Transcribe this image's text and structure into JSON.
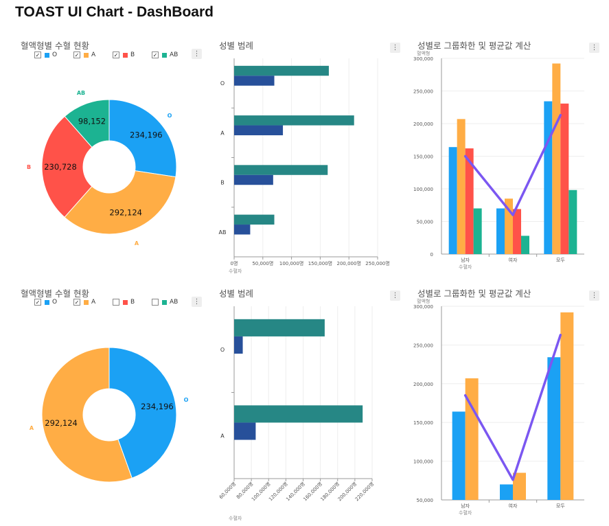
{
  "page_title": "TOAST UI Chart - DashBoard",
  "colors": {
    "O": "#1ba1f4",
    "A": "#ffad45",
    "B": "#ff5249",
    "AB": "#1cb392",
    "female": "#268785",
    "male": "#27509a",
    "avg": "#7b57f1"
  },
  "menu_icon": "⋮",
  "check_mark": "✓",
  "panels": {
    "pie_top": {
      "title": "혈액형별 수혈 현황"
    },
    "bar_top": {
      "title": "성별 범례",
      "ytitle": "혈액형",
      "xtitle": "수혈자"
    },
    "col_top": {
      "title": "성별로 그룹화한 및 평균값 계산",
      "ytitle": "혈액형",
      "xtitle": "수혈자"
    },
    "pie_bot": {
      "title": "혈액형별 수혈 현황"
    },
    "bar_bot": {
      "title": "성별 범례",
      "ytitle": "혈액형",
      "xtitle": "수혈자"
    },
    "col_bot": {
      "title": "성별로 그룹화한 및 평균값 계산",
      "ytitle": "혈액형",
      "xtitle": "수혈자"
    }
  },
  "legend_top": [
    {
      "label": "O",
      "checked": true
    },
    {
      "label": "A",
      "checked": true
    },
    {
      "label": "B",
      "checked": true
    },
    {
      "label": "AB",
      "checked": true
    }
  ],
  "legend_bot": [
    {
      "label": "O",
      "checked": true
    },
    {
      "label": "A",
      "checked": true
    },
    {
      "label": "B",
      "checked": false
    },
    {
      "label": "AB",
      "checked": false
    }
  ],
  "chart_data": [
    {
      "id": "pie_top",
      "type": "pie",
      "categories": [
        "O",
        "A",
        "B",
        "AB"
      ],
      "values": [
        234196,
        292124,
        230728,
        98152
      ],
      "labels": [
        "234,196",
        "292,124",
        "230,728",
        "98,152"
      ]
    },
    {
      "id": "bar_top",
      "type": "bar",
      "categories": [
        "O",
        "A",
        "B",
        "AB"
      ],
      "series": [
        {
          "values": [
            165000,
            209000,
            163000,
            70000
          ]
        },
        {
          "values": [
            70000,
            85000,
            68000,
            28000
          ]
        }
      ],
      "xlim": [
        0,
        250000
      ],
      "xticks": [
        0,
        50000,
        100000,
        150000,
        200000,
        250000
      ],
      "xtick_labels": [
        "0명",
        "50,000명",
        "100,000명",
        "150,000명",
        "200,000명",
        "250,000명"
      ]
    },
    {
      "id": "col_top",
      "type": "bar",
      "categories": [
        "남자",
        "여자",
        "모두"
      ],
      "series": [
        {
          "name": "O",
          "values": [
            164000,
            70000,
            234196
          ]
        },
        {
          "name": "A",
          "values": [
            207000,
            85000,
            292124
          ]
        },
        {
          "name": "B",
          "values": [
            162000,
            69000,
            230728
          ]
        },
        {
          "name": "AB",
          "values": [
            70000,
            28000,
            98152
          ]
        }
      ],
      "line": [
        150000,
        60000,
        213000
      ],
      "ylim": [
        0,
        300000
      ],
      "yticks": [
        0,
        50000,
        100000,
        150000,
        200000,
        250000,
        300000
      ],
      "ytick_labels": [
        "0",
        "50,000",
        "100,000",
        "150,000",
        "200,000",
        "250,000",
        "300,000"
      ]
    },
    {
      "id": "pie_bot",
      "type": "pie",
      "categories": [
        "O",
        "A"
      ],
      "values": [
        234196,
        292124
      ],
      "labels": [
        "234,196",
        "292,124"
      ]
    },
    {
      "id": "bar_bot",
      "type": "bar",
      "categories": [
        "O",
        "A"
      ],
      "series": [
        {
          "values": [
            165000,
            209000
          ]
        },
        {
          "values": [
            70000,
            85000
          ]
        }
      ],
      "xlim": [
        60000,
        220000
      ],
      "xticks": [
        60000,
        80000,
        100000,
        120000,
        140000,
        160000,
        180000,
        200000,
        220000
      ],
      "xtick_labels": [
        "60,000명",
        "80,000명",
        "100,000명",
        "120,000명",
        "140,000명",
        "160,000명",
        "180,000명",
        "200,000명",
        "220,000명"
      ]
    },
    {
      "id": "col_bot",
      "type": "bar",
      "categories": [
        "남자",
        "여자",
        "모두"
      ],
      "series": [
        {
          "name": "O",
          "values": [
            164000,
            70000,
            234196
          ]
        },
        {
          "name": "A",
          "values": [
            207000,
            85000,
            292124
          ]
        }
      ],
      "line": [
        185000,
        76000,
        263000
      ],
      "ylim": [
        50000,
        300000
      ],
      "yticks": [
        50000,
        100000,
        150000,
        200000,
        250000,
        300000
      ],
      "ytick_labels": [
        "50,000",
        "100,000",
        "150,000",
        "200,000",
        "250,000",
        "300,000"
      ]
    }
  ]
}
